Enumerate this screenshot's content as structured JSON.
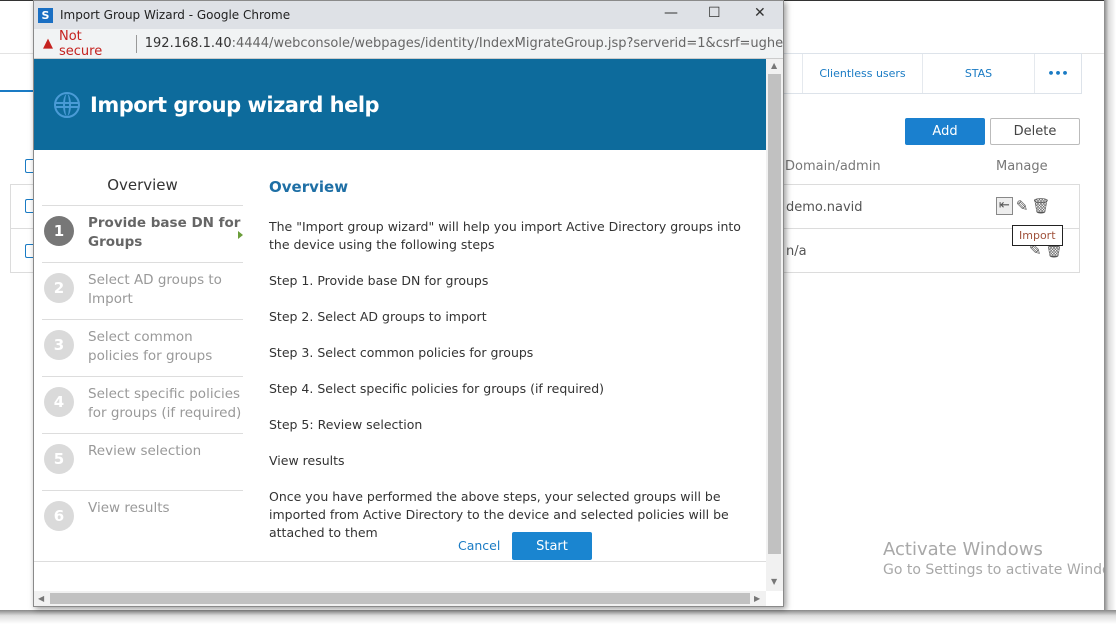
{
  "background": {
    "tabs": [
      "Clientless users",
      "STAS",
      "•••"
    ],
    "add_label": "Add",
    "delete_label": "Delete",
    "columns": {
      "domain": "Domain/admin",
      "manage": "Manage"
    },
    "rows": [
      {
        "domain": "demo.navid"
      },
      {
        "domain": "n/a"
      }
    ],
    "tooltip": "Import",
    "watermark": {
      "title": "Activate Windows",
      "subtitle": "Go to Settings to activate Windows."
    }
  },
  "window": {
    "title": "Import Group Wizard - Google Chrome",
    "security": "Not secure",
    "url_host": "192.168.1.40",
    "url_rest": ":4444/webconsole/webpages/identity/IndexMigrateGroup.jsp?serverid=1&csrf=ughe..."
  },
  "wizard": {
    "header": "Import group wizard help",
    "nav_title": "Overview",
    "steps": [
      {
        "num": "1",
        "label": "Provide base DN for Groups",
        "active": true
      },
      {
        "num": "2",
        "label": "Select AD groups to Import"
      },
      {
        "num": "3",
        "label": "Select common policies for groups"
      },
      {
        "num": "4",
        "label": "Select specific policies for groups (if required)"
      },
      {
        "num": "5",
        "label": "Review selection"
      },
      {
        "num": "6",
        "label": "View results"
      }
    ],
    "heading": "Overview",
    "paragraphs": [
      "The \"Import group wizard\" will help you import Active Directory groups into the device using the following steps",
      "Step 1. Provide base DN for groups",
      "Step 2. Select AD groups to import",
      "Step 3. Select common policies for groups",
      "Step 4. Select specific policies for groups (if required)",
      "Step 5: Review selection",
      "View results",
      "Once you have performed the above steps, your selected groups will be imported from Active Directory to the device and selected policies will be attached to them"
    ],
    "cancel_label": "Cancel",
    "start_label": "Start"
  },
  "colors": {
    "header": "#0d6b9c",
    "accent": "#1a85d0"
  }
}
